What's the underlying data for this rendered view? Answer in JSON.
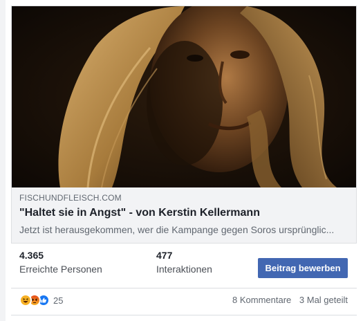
{
  "preview": {
    "domain": "FISCHUNDFLEISCH.COM",
    "title": "\"Haltet sie in Angst\" - von Kerstin Kellermann",
    "description": "Jetzt ist herausgekommen, wer die Kampange gegen Soros ursprünglic..."
  },
  "stats": {
    "reach_value": "4.365",
    "reach_label": "Erreichte Personen",
    "interactions_value": "477",
    "interactions_label": "Interaktionen",
    "boost_label": "Beitrag bewerben"
  },
  "reactions": {
    "icons": [
      "haha-icon",
      "angry-icon",
      "like-icon"
    ],
    "count": "25"
  },
  "engagement": {
    "comments": "8 Kommentare",
    "shares": "3 Mal geteilt"
  },
  "colors": {
    "button": "#4267b2",
    "title": "#1d2129",
    "muted": "#606770",
    "like": "#1877f2",
    "haha": "#f7b125",
    "angry": "#e9710f"
  }
}
